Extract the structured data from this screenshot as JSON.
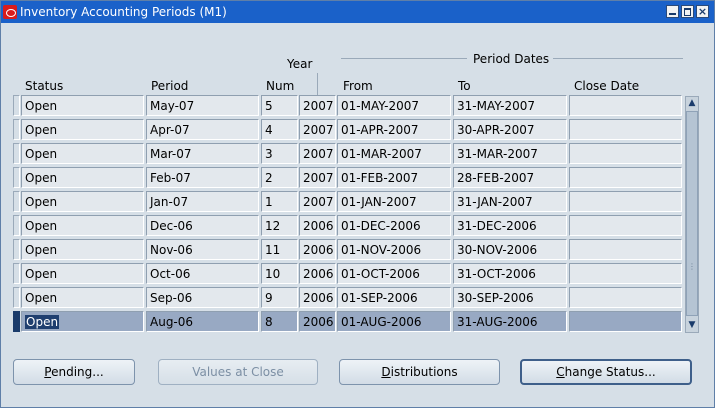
{
  "window": {
    "title": "Inventory Accounting Periods (M1)",
    "accent_color": "#1a61c9"
  },
  "headers": {
    "status": "Status",
    "period": "Period",
    "year": "Year",
    "num": "Num",
    "period_dates_group": "Period Dates",
    "from": "From",
    "to": "To",
    "close_date": "Close Date"
  },
  "rows": [
    {
      "status": "Open",
      "period": "May-07",
      "num": "5",
      "year": "2007",
      "from": "01-MAY-2007",
      "to": "31-MAY-2007",
      "close_date": ""
    },
    {
      "status": "Open",
      "period": "Apr-07",
      "num": "4",
      "year": "2007",
      "from": "01-APR-2007",
      "to": "30-APR-2007",
      "close_date": ""
    },
    {
      "status": "Open",
      "period": "Mar-07",
      "num": "3",
      "year": "2007",
      "from": "01-MAR-2007",
      "to": "31-MAR-2007",
      "close_date": ""
    },
    {
      "status": "Open",
      "period": "Feb-07",
      "num": "2",
      "year": "2007",
      "from": "01-FEB-2007",
      "to": "28-FEB-2007",
      "close_date": ""
    },
    {
      "status": "Open",
      "period": "Jan-07",
      "num": "1",
      "year": "2007",
      "from": "01-JAN-2007",
      "to": "31-JAN-2007",
      "close_date": ""
    },
    {
      "status": "Open",
      "period": "Dec-06",
      "num": "12",
      "year": "2006",
      "from": "01-DEC-2006",
      "to": "31-DEC-2006",
      "close_date": ""
    },
    {
      "status": "Open",
      "period": "Nov-06",
      "num": "11",
      "year": "2006",
      "from": "01-NOV-2006",
      "to": "30-NOV-2006",
      "close_date": ""
    },
    {
      "status": "Open",
      "period": "Oct-06",
      "num": "10",
      "year": "2006",
      "from": "01-OCT-2006",
      "to": "31-OCT-2006",
      "close_date": ""
    },
    {
      "status": "Open",
      "period": "Sep-06",
      "num": "9",
      "year": "2006",
      "from": "01-SEP-2006",
      "to": "30-SEP-2006",
      "close_date": ""
    },
    {
      "status": "Open",
      "period": "Aug-06",
      "num": "8",
      "year": "2006",
      "from": "01-AUG-2006",
      "to": "31-AUG-2006",
      "close_date": ""
    }
  ],
  "selected_row_index": 9,
  "buttons": {
    "pending": {
      "label_pre": "",
      "label_u": "P",
      "label_post": "ending..."
    },
    "values_at_close": {
      "label": "Values at Close",
      "disabled": true
    },
    "distributions": {
      "label_pre": "",
      "label_u": "D",
      "label_post": "istributions"
    },
    "change_status": {
      "label_pre": "",
      "label_u": "C",
      "label_post": "hange Status..."
    }
  },
  "icons": {
    "app_logo": "oracle-logo-icon",
    "minimize": "minimize-icon",
    "maximize": "maximize-icon",
    "close": "close-icon",
    "scroll_up": "arrow-up-icon",
    "scroll_down": "arrow-down-icon"
  }
}
